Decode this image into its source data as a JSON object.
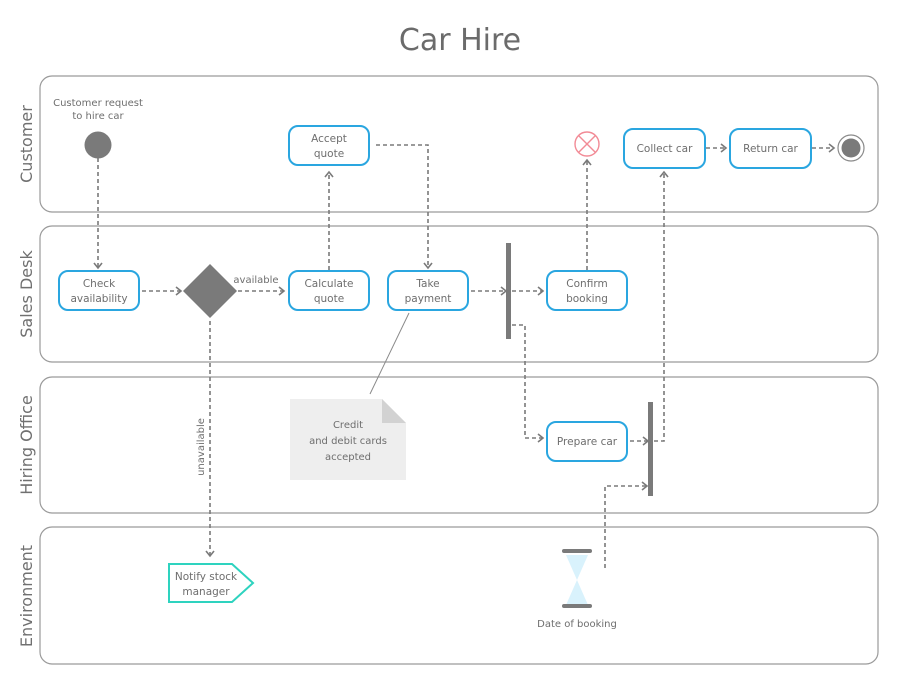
{
  "title": "Car Hire",
  "lanes": [
    {
      "id": "customer",
      "label": "Customer"
    },
    {
      "id": "sales-desk",
      "label": "Sales Desk"
    },
    {
      "id": "hiring-office",
      "label": "Hiring Office"
    },
    {
      "id": "environment",
      "label": "Environment"
    }
  ],
  "nodes": {
    "start": {
      "label_line1": "Customer request",
      "label_line2": "to hire car"
    },
    "accept_quote": {
      "line1": "Accept",
      "line2": "quote"
    },
    "collect_car": {
      "line1": "Collect car"
    },
    "return_car": {
      "line1": "Return car"
    },
    "check_availability": {
      "line1": "Check",
      "line2": "availability"
    },
    "calculate_quote": {
      "line1": "Calculate",
      "line2": "quote"
    },
    "take_payment": {
      "line1": "Take",
      "line2": "payment"
    },
    "confirm_booking": {
      "line1": "Confirm",
      "line2": "booking"
    },
    "prepare_car": {
      "line1": "Prepare car"
    },
    "notify_stock_manager": {
      "line1": "Notify stock",
      "line2": "manager"
    },
    "date_of_booking": {
      "label": "Date of booking"
    }
  },
  "guards": {
    "available": "available",
    "unavailable": "unavailable"
  },
  "note": {
    "line1": "Credit",
    "line2": "and debit cards",
    "line3": "accepted"
  },
  "colors": {
    "action_border": "#2aa6e0",
    "signal_border": "#2ed3bf",
    "flow_final": "#f28b96",
    "node_fill": "#7a7a7a",
    "note_fill": "#eeeeee",
    "hourglass_sand": "#d9f2fc"
  }
}
